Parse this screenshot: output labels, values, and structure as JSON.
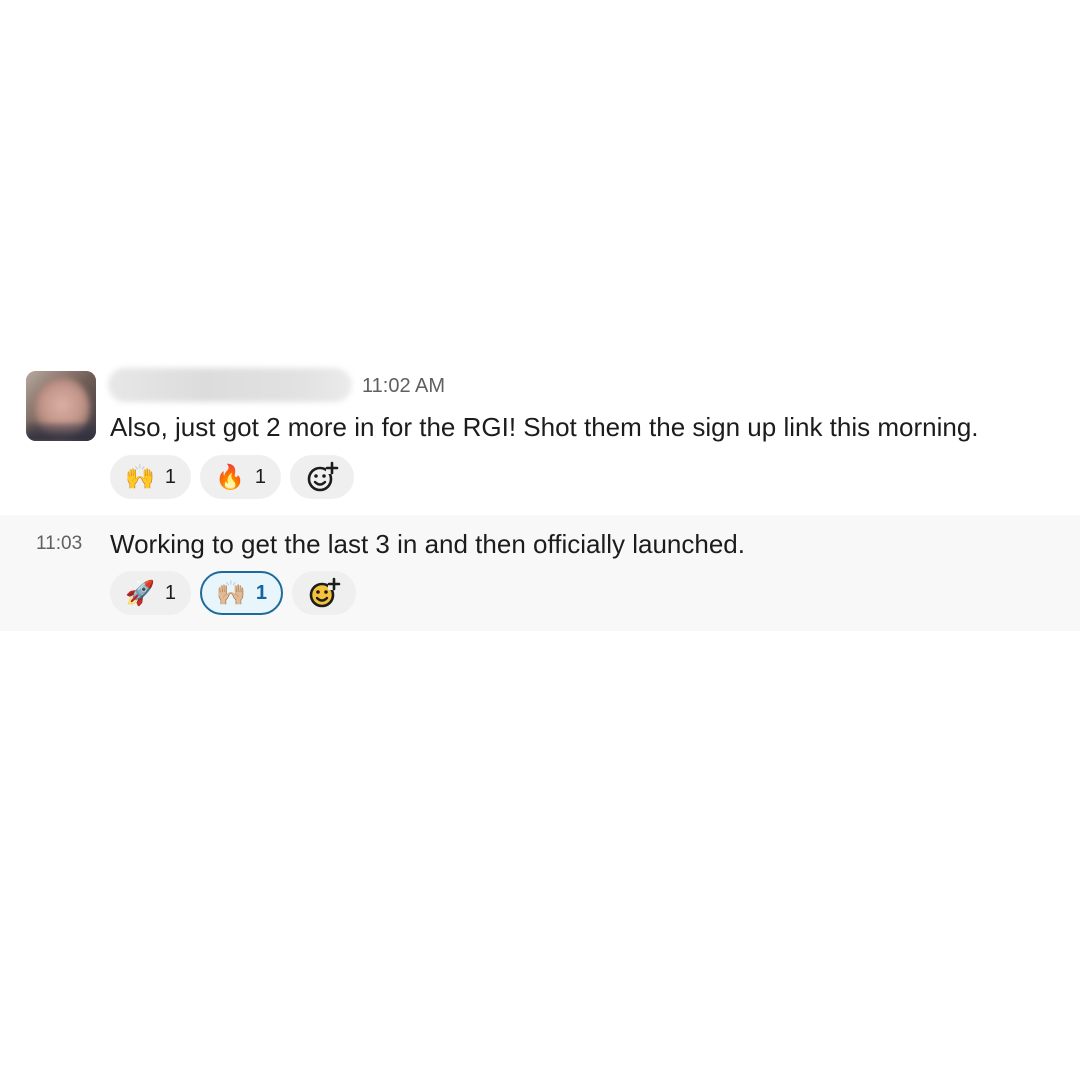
{
  "messages": [
    {
      "timestamp": "11:02 AM",
      "text": "Also, just got 2 more in for the RGI! Shot them the sign up link this morning.",
      "reactions": [
        {
          "emoji": "🙌",
          "icon": "raising-hands-icon",
          "count": "1",
          "active": false
        },
        {
          "emoji": "🔥",
          "icon": "fire-icon",
          "count": "1",
          "active": false
        }
      ]
    },
    {
      "hover_time": "11:03",
      "text": "Working to get the last 3 in and then officially launched.",
      "reactions": [
        {
          "emoji": "🚀",
          "icon": "rocket-icon",
          "count": "1",
          "active": false
        },
        {
          "emoji": "🙌🏼",
          "icon": "raising-hands-light-icon",
          "count": "1",
          "active": true
        }
      ]
    }
  ],
  "colors": {
    "accent_border": "#1d6a9c",
    "accent_count": "#1264a3",
    "reaction_bg": "#efefef",
    "hover_row_bg": "#f8f8f8"
  }
}
